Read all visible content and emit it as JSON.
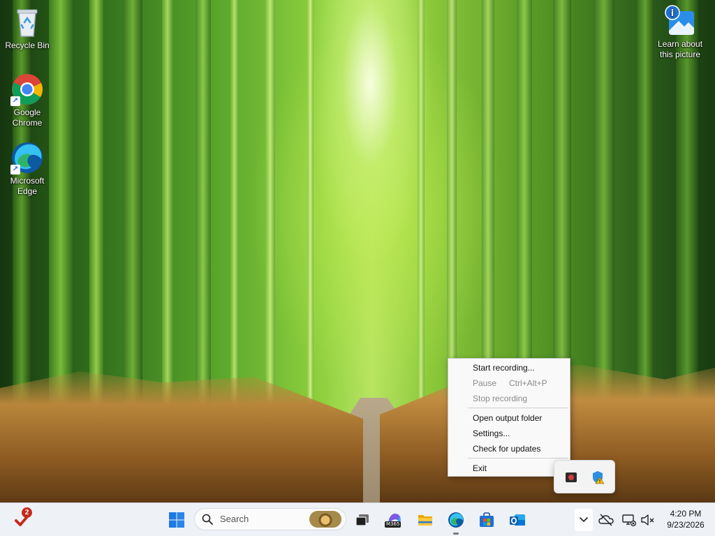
{
  "desktop": {
    "icons": [
      {
        "label": "Recycle Bin",
        "icon": "recycle-bin-icon"
      },
      {
        "label": "Google Chrome",
        "icon": "chrome-icon"
      },
      {
        "label": "Microsoft Edge",
        "icon": "edge-icon"
      },
      {
        "label": "Learn about this picture",
        "icon": "learn-picture-icon"
      }
    ]
  },
  "context_menu": {
    "items": [
      {
        "label": "Start recording...",
        "enabled": true
      },
      {
        "label": "Pause",
        "shortcut": "Ctrl+Alt+P",
        "enabled": false
      },
      {
        "label": "Stop recording",
        "enabled": false
      },
      {
        "label": "Open output folder",
        "enabled": true
      },
      {
        "label": "Settings...",
        "enabled": true
      },
      {
        "label": "Check for updates",
        "enabled": true
      },
      {
        "label": "Exit",
        "enabled": true
      }
    ]
  },
  "taskbar": {
    "notification_count": "2",
    "search_placeholder": "Search",
    "m365_label": "M365",
    "pinned_apps": [
      "start-icon",
      "task-view-icon",
      "m365-copilot-icon",
      "file-explorer-icon",
      "edge-icon",
      "microsoft-store-icon",
      "outlook-icon"
    ],
    "tray_icons": [
      "show-hidden-icons-chevron",
      "onedrive-offline-icon",
      "network-icon",
      "volume-muted-icon"
    ],
    "clock": {
      "time": "4:20 PM",
      "date": "9/23/2026"
    }
  },
  "tray_flyout": {
    "icons": [
      "recorder-app-icon",
      "security-warning-icon"
    ]
  },
  "colors": {
    "taskbar_bg": "#eef1f6",
    "menu_bg": "#f9f9f9",
    "notification_badge": "#c42b1c",
    "windows_blue": "#0078d4"
  }
}
